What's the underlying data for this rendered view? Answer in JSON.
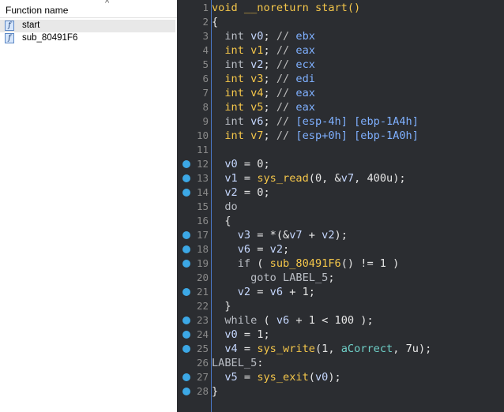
{
  "functions_panel": {
    "header": "Function name",
    "sort_indicator": "^",
    "items": [
      {
        "icon": "function-icon",
        "glyph": "f",
        "name": "start",
        "selected": true
      },
      {
        "icon": "function-icon",
        "glyph": "f",
        "name": "sub_80491F6",
        "selected": false
      }
    ]
  },
  "pseudocode": {
    "lines": [
      {
        "n": "1",
        "dot": false,
        "tokens": [
          [
            "kw-y",
            "void __noreturn start()"
          ]
        ]
      },
      {
        "n": "2",
        "dot": false,
        "tokens": [
          [
            "pl",
            "{"
          ]
        ]
      },
      {
        "n": "3",
        "dot": false,
        "tokens": [
          [
            "kw-g",
            "  int "
          ],
          [
            "var",
            "v0"
          ],
          [
            "pl",
            "; "
          ],
          [
            "cm",
            "// "
          ],
          [
            "cb",
            "ebx"
          ]
        ]
      },
      {
        "n": "4",
        "dot": false,
        "tokens": [
          [
            "kw-y",
            "  int v1"
          ],
          [
            "pl",
            "; "
          ],
          [
            "cm",
            "// "
          ],
          [
            "cb",
            "eax"
          ]
        ]
      },
      {
        "n": "5",
        "dot": false,
        "tokens": [
          [
            "kw-g",
            "  int "
          ],
          [
            "var",
            "v2"
          ],
          [
            "pl",
            "; "
          ],
          [
            "cm",
            "// "
          ],
          [
            "cb",
            "ecx"
          ]
        ]
      },
      {
        "n": "6",
        "dot": false,
        "tokens": [
          [
            "kw-y",
            "  int v3"
          ],
          [
            "pl",
            "; "
          ],
          [
            "cm",
            "// "
          ],
          [
            "cb",
            "edi"
          ]
        ]
      },
      {
        "n": "7",
        "dot": false,
        "tokens": [
          [
            "kw-y",
            "  int v4"
          ],
          [
            "pl",
            "; "
          ],
          [
            "cm",
            "// "
          ],
          [
            "cb",
            "eax"
          ]
        ]
      },
      {
        "n": "8",
        "dot": false,
        "tokens": [
          [
            "kw-y",
            "  int v5"
          ],
          [
            "pl",
            "; "
          ],
          [
            "cm",
            "// "
          ],
          [
            "cb",
            "eax"
          ]
        ]
      },
      {
        "n": "9",
        "dot": false,
        "tokens": [
          [
            "kw-g",
            "  int "
          ],
          [
            "var",
            "v6"
          ],
          [
            "pl",
            "; "
          ],
          [
            "cm",
            "// "
          ],
          [
            "cb",
            "[esp-4h] [ebp-1A4h]"
          ]
        ]
      },
      {
        "n": "10",
        "dot": false,
        "tokens": [
          [
            "kw-y",
            "  int v7"
          ],
          [
            "pl",
            "; "
          ],
          [
            "cm",
            "// "
          ],
          [
            "cb",
            "[esp+0h] [ebp-1A0h]"
          ]
        ]
      },
      {
        "n": "11",
        "dot": false,
        "tokens": [
          [
            "pl",
            ""
          ]
        ]
      },
      {
        "n": "12",
        "dot": true,
        "tokens": [
          [
            "var",
            "  v0"
          ],
          [
            "pl",
            " = 0;"
          ]
        ]
      },
      {
        "n": "13",
        "dot": true,
        "tokens": [
          [
            "var",
            "  v1"
          ],
          [
            "pl",
            " = "
          ],
          [
            "fn",
            "sys_read"
          ],
          [
            "pl",
            "(0, &"
          ],
          [
            "var",
            "v7"
          ],
          [
            "pl",
            ", 400u);"
          ]
        ]
      },
      {
        "n": "14",
        "dot": true,
        "tokens": [
          [
            "var",
            "  v2"
          ],
          [
            "pl",
            " = 0;"
          ]
        ]
      },
      {
        "n": "15",
        "dot": false,
        "tokens": [
          [
            "kw-g",
            "  do"
          ]
        ]
      },
      {
        "n": "16",
        "dot": false,
        "tokens": [
          [
            "pl",
            "  {"
          ]
        ]
      },
      {
        "n": "17",
        "dot": true,
        "tokens": [
          [
            "var",
            "    v3"
          ],
          [
            "pl",
            " = *(&"
          ],
          [
            "var",
            "v7"
          ],
          [
            "pl",
            " + "
          ],
          [
            "var",
            "v2"
          ],
          [
            "pl",
            ");"
          ]
        ]
      },
      {
        "n": "18",
        "dot": true,
        "tokens": [
          [
            "var",
            "    v6"
          ],
          [
            "pl",
            " = "
          ],
          [
            "var",
            "v2"
          ],
          [
            "pl",
            ";"
          ]
        ]
      },
      {
        "n": "19",
        "dot": true,
        "tokens": [
          [
            "kw-g",
            "    if"
          ],
          [
            "pl",
            " ( "
          ],
          [
            "fn",
            "sub_80491F6"
          ],
          [
            "pl",
            "() != 1 )"
          ]
        ]
      },
      {
        "n": "20",
        "dot": false,
        "tokens": [
          [
            "kw-g",
            "      goto LABEL_5"
          ],
          [
            "pl",
            ";"
          ]
        ]
      },
      {
        "n": "21",
        "dot": true,
        "tokens": [
          [
            "var",
            "    v2"
          ],
          [
            "pl",
            " = "
          ],
          [
            "var",
            "v6"
          ],
          [
            "pl",
            " + 1;"
          ]
        ]
      },
      {
        "n": "22",
        "dot": false,
        "tokens": [
          [
            "pl",
            "  }"
          ]
        ]
      },
      {
        "n": "23",
        "dot": true,
        "tokens": [
          [
            "kw-g",
            "  while"
          ],
          [
            "pl",
            " ( "
          ],
          [
            "var",
            "v6"
          ],
          [
            "pl",
            " + 1 < 100 );"
          ]
        ]
      },
      {
        "n": "24",
        "dot": true,
        "tokens": [
          [
            "var",
            "  v0"
          ],
          [
            "pl",
            " = 1;"
          ]
        ]
      },
      {
        "n": "25",
        "dot": true,
        "tokens": [
          [
            "var",
            "  v4"
          ],
          [
            "pl",
            " = "
          ],
          [
            "fn",
            "sys_write"
          ],
          [
            "pl",
            "(1, "
          ],
          [
            "str",
            "aCorrect"
          ],
          [
            "pl",
            ", 7u);"
          ]
        ]
      },
      {
        "n": "26",
        "dot": false,
        "tokens": [
          [
            "kw-g",
            "LABEL_5"
          ],
          [
            "pl",
            ":"
          ]
        ]
      },
      {
        "n": "27",
        "dot": true,
        "tokens": [
          [
            "var",
            "  v5"
          ],
          [
            "pl",
            " = "
          ],
          [
            "fn",
            "sys_exit"
          ],
          [
            "pl",
            "("
          ],
          [
            "var",
            "v0"
          ],
          [
            "pl",
            ");"
          ]
        ]
      },
      {
        "n": "28",
        "dot": true,
        "tokens": [
          [
            "pl",
            "}"
          ]
        ]
      }
    ]
  },
  "colors": {
    "code_background": "#2b2d31",
    "keyword_yellow": "#f4c64a",
    "breakpoint_dot": "#3ca8e6",
    "panel_background": "#ffffff"
  }
}
